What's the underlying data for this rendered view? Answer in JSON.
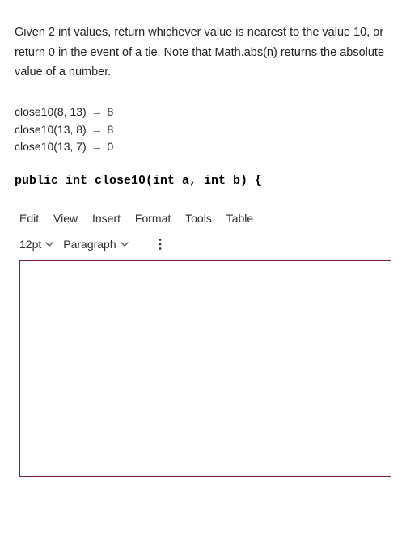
{
  "problem": {
    "statement": "Given 2 int values, return whichever value is nearest to the value 10, or return 0 in the event of a tie. Note that Math.abs(n) returns the absolute value of a number."
  },
  "examples": [
    {
      "call": "close10(8, 13)",
      "result": "8"
    },
    {
      "call": "close10(13, 8)",
      "result": "8"
    },
    {
      "call": "close10(13, 7)",
      "result": "0"
    }
  ],
  "signature": "public int close10(int a, int b) {",
  "menu": {
    "edit": "Edit",
    "view": "View",
    "insert": "Insert",
    "format": "Format",
    "tools": "Tools",
    "table": "Table"
  },
  "toolbar": {
    "fontsize": "12pt",
    "paragraph": "Paragraph"
  },
  "arrow": "→"
}
